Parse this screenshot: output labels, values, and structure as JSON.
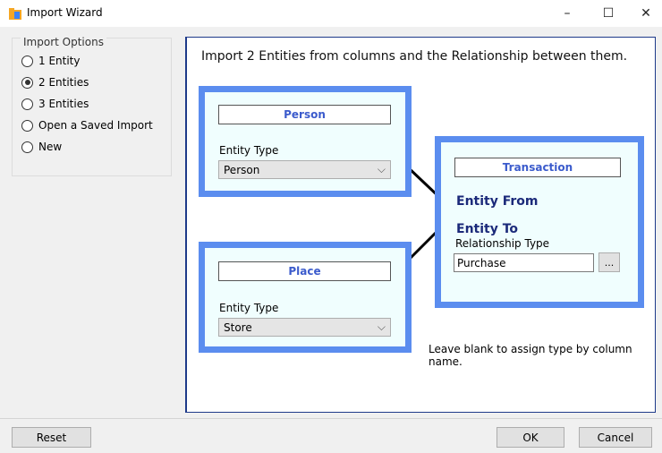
{
  "window": {
    "title": "Import Wizard",
    "minimize": "–",
    "maximize": "☐",
    "close": "✕"
  },
  "options": {
    "title": "Import Options",
    "items": [
      {
        "label": "1 Entity",
        "checked": false
      },
      {
        "label": "2 Entities",
        "checked": true
      },
      {
        "label": "3 Entities",
        "checked": false
      },
      {
        "label": "Open a Saved Import",
        "checked": false
      },
      {
        "label": "New",
        "checked": false
      }
    ]
  },
  "main": {
    "heading": "Import 2 Entities from columns and the Relationship between them.",
    "entity1": {
      "name": "Person",
      "type_label": "Entity Type",
      "type_value": "Person"
    },
    "entity2": {
      "name": "Place",
      "type_label": "Entity Type",
      "type_value": "Store"
    },
    "link": {
      "name": "Transaction",
      "from_label": "Entity From",
      "to_label": "Entity To",
      "type_label": "Relationship Type",
      "type_value": "Purchase",
      "browse_label": "..."
    },
    "hint": "Leave blank to assign type by column name."
  },
  "footer": {
    "reset": "Reset",
    "ok": "OK",
    "cancel": "Cancel"
  },
  "colors": {
    "box_border": "#5b8def",
    "box_fill": "#f0fefe",
    "name_text": "#3b5bcc",
    "bold_text": "#1b2a7a",
    "panel_border": "#1e3a8a"
  }
}
